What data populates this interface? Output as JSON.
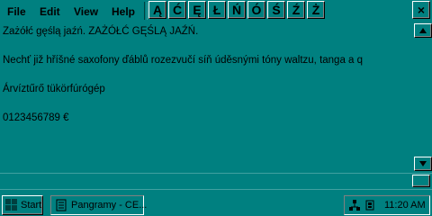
{
  "menu": {
    "file": "File",
    "edit": "Edit",
    "view": "View",
    "help": "Help"
  },
  "char_buttons": [
    "Ą",
    "Ć",
    "Ę",
    "Ł",
    "Ń",
    "Ó",
    "Ś",
    "Ź",
    "Ż"
  ],
  "close_label": "×",
  "editor_lines": [
    "Zażółć gęślą jaźń. ZAŻÓŁĆ GĘŚLĄ JAŹŃ.",
    "Nechť již hříšné saxofony ďáblů rozezvučí síň úděsnými tóny waltzu, tanga a q",
    "Árvíztűrő tükörfúrógép",
    "0123456789 €"
  ],
  "taskbar": {
    "start_label": "Start",
    "task_label": "Pangramy - CE...",
    "clock": "11:20 AM"
  },
  "colors": {
    "desktop": "#008080",
    "text": "#000000"
  },
  "icons": {
    "scroll_up": "triangle-up",
    "scroll_down": "triangle-down",
    "start": "windows-flag",
    "task": "notepad-icon",
    "tray": [
      "network-icon",
      "volume-icon"
    ]
  }
}
